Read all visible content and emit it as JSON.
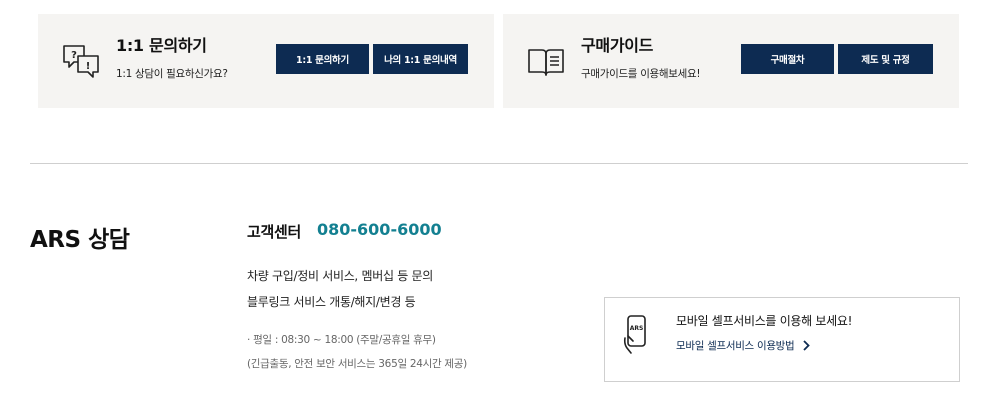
{
  "inquiry_card": {
    "title": "1:1 문의하기",
    "subtitle": "1:1 상담이 필요하신가요?",
    "icon": "chat-bubbles-icon",
    "buttons": [
      "1:1 문의하기",
      "나의 1:1 문의내역"
    ]
  },
  "guide_card": {
    "title": "구매가이드",
    "subtitle": "구매가이드를 이용해보세요!",
    "icon": "book-icon",
    "buttons": [
      "구매절차",
      "제도 및 규정"
    ]
  },
  "ars": {
    "title": "ARS 상담",
    "center_label": "고객센터",
    "phone": "080-600-6000",
    "desc_line1": "차량 구입/정비 서비스, 멤버십 등 문의",
    "desc_line2": "블루링크 서비스 개통/해지/변경 등",
    "hours_line1": "· 평일 : 08:30 ~ 18:00 (주말/공휴일 휴무)",
    "hours_line2": "(긴급출동, 안전 보안 서비스는 365일 24시간 제공)"
  },
  "mobile": {
    "title": "모바일 셀프서비스를 이용해 보세요!",
    "link": "모바일 셀프서비스 이용방법",
    "icon_text": "ARS"
  },
  "colors": {
    "button_bg": "#0d2b52",
    "phone": "#138091",
    "card_bg": "#f5f4f2"
  }
}
